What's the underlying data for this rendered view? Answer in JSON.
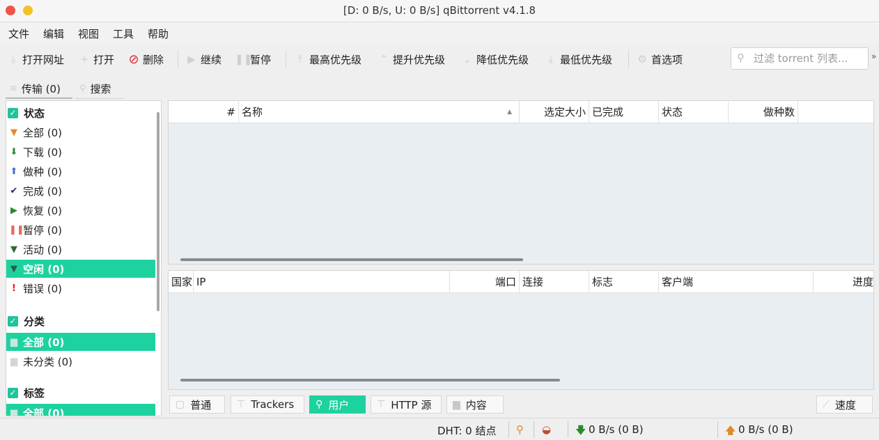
{
  "window": {
    "title": "[D: 0 B/s, U: 0 B/s] qBittorrent v4.1.8"
  },
  "menu": [
    "文件",
    "编辑",
    "视图",
    "工具",
    "帮助"
  ],
  "toolbar": {
    "open_url": "打开网址",
    "open": "打开",
    "delete": "删除",
    "resume": "继续",
    "pause": "暂停",
    "top_priority": "最高优先级",
    "increase_priority": "提升优先级",
    "decrease_priority": "降低优先级",
    "bottom_priority": "最低优先级",
    "options": "首选项",
    "filter_placeholder": "过滤 torrent 列表..."
  },
  "tabs": {
    "transfer": "传输 (0)",
    "search": "搜索"
  },
  "sidebar": {
    "status_header": "状态",
    "status_items": [
      {
        "label": "全部 (0)",
        "icon": "filter-icon",
        "color": "#e08a2c"
      },
      {
        "label": "下载 (0)",
        "icon": "download-arrow-icon",
        "color": "#2c8a2c"
      },
      {
        "label": "做种 (0)",
        "icon": "upload-arrow-icon",
        "color": "#3a6fd6"
      },
      {
        "label": "完成 (0)",
        "icon": "check-icon",
        "color": "#1a2a6a"
      },
      {
        "label": "恢复 (0)",
        "icon": "play-icon",
        "color": "#2c8a2c"
      },
      {
        "label": "暂停 (0)",
        "icon": "pause-icon",
        "color": "#e46a5e"
      },
      {
        "label": "活动 (0)",
        "icon": "filter-icon",
        "color": "#2c6a3c"
      },
      {
        "label": "空闲 (0)",
        "icon": "filter-icon",
        "color": "#2a5a4c",
        "selected": true
      },
      {
        "label": "错误 (0)",
        "icon": "exclamation-icon",
        "color": "#e01818"
      }
    ],
    "category_header": "分类",
    "category_items": [
      {
        "label": "全部 (0)",
        "selected": true
      },
      {
        "label": "未分类 (0)"
      }
    ],
    "tag_header": "标签",
    "tag_items": [
      {
        "label": "全部 (0)",
        "selected": true
      }
    ]
  },
  "torrent_table": {
    "columns": [
      "#",
      "名称",
      "选定大小",
      "已完成",
      "状态",
      "做种数"
    ]
  },
  "peer_table": {
    "columns": [
      "国家",
      "IP",
      "端口",
      "连接",
      "标志",
      "客户端",
      "进度"
    ]
  },
  "properties_tabs": {
    "general": "普通",
    "trackers": "Trackers",
    "peers": "用户",
    "http_sources": "HTTP 源",
    "content": "内容",
    "speed": "速度"
  },
  "statusbar": {
    "dht": "DHT:  0 结点",
    "download": "0 B/s (0 B)",
    "upload": "0 B/s (0 B)"
  },
  "colors": {
    "accent": "#1ed2a0"
  }
}
